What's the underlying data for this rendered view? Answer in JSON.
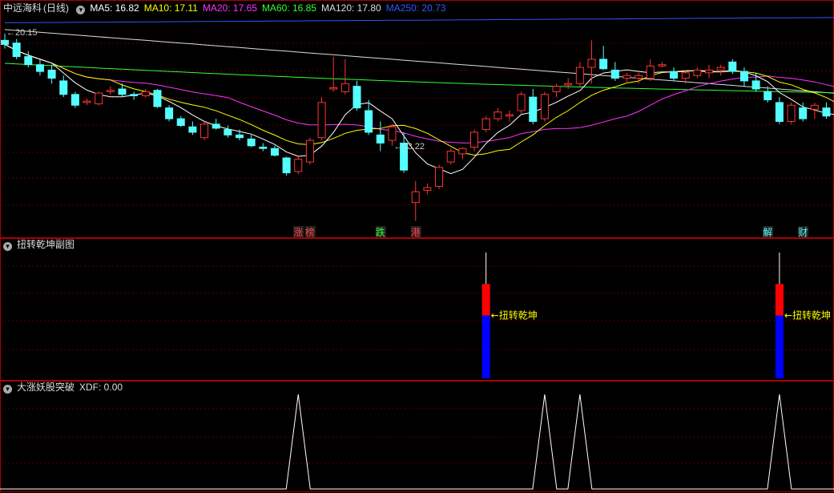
{
  "header": {
    "stock_name": "中远海科",
    "period": "(日线)",
    "ma": [
      {
        "label": "MA5: 16.82",
        "color": "#ffffff"
      },
      {
        "label": "MA10: 17.11",
        "color": "#ffff00"
      },
      {
        "label": "MA20: 17.65",
        "color": "#ff33ff"
      },
      {
        "label": "MA60: 16.85",
        "color": "#33ff33"
      },
      {
        "label": "MA120: 17.80",
        "color": "#dddddd"
      },
      {
        "label": "MA250: 20.73",
        "color": "#3355ff"
      }
    ]
  },
  "panel2": {
    "title": "扭转乾坤副图"
  },
  "panel3": {
    "title": "大涨妖股突破",
    "value_label": "XDF: 0.00"
  },
  "colors": {
    "up": "#ff3333",
    "down": "#54ffff",
    "grid": "#5a0000",
    "border": "#aa0000"
  },
  "chart_data": [
    {
      "type": "candlestick",
      "title": "中远海科 (日线)",
      "annotations": [
        {
          "text": "20.15",
          "at_index": 0,
          "kind": "high"
        },
        {
          "text": "13.22",
          "at_index": 33,
          "kind": "low"
        }
      ],
      "event_tags": [
        {
          "text": "涨",
          "at_index": 25,
          "color": "#ff4444"
        },
        {
          "text": "榜",
          "at_index": 26,
          "color": "#ff4444"
        },
        {
          "text": "跌",
          "at_index": 32,
          "color": "#33ff33"
        },
        {
          "text": "港",
          "at_index": 35,
          "color": "#ff4444"
        },
        {
          "text": "解",
          "at_index": 65,
          "color": "#54ffff"
        },
        {
          "text": "财",
          "at_index": 68,
          "color": "#54ffff"
        }
      ],
      "ohlc": [
        [
          19.9,
          20.15,
          19.6,
          19.75
        ],
        [
          19.8,
          19.95,
          19.2,
          19.3
        ],
        [
          19.3,
          19.5,
          18.9,
          19.0
        ],
        [
          19.0,
          19.2,
          18.6,
          18.75
        ],
        [
          18.8,
          19.0,
          18.3,
          18.5
        ],
        [
          18.4,
          18.6,
          17.8,
          17.9
        ],
        [
          17.9,
          18.0,
          17.4,
          17.5
        ],
        [
          17.6,
          17.75,
          17.5,
          17.65
        ],
        [
          17.55,
          18.0,
          17.5,
          17.95
        ],
        [
          18.0,
          18.2,
          17.9,
          18.05
        ],
        [
          18.1,
          18.3,
          17.8,
          17.9
        ],
        [
          17.9,
          18.0,
          17.7,
          17.85
        ],
        [
          17.85,
          18.1,
          17.8,
          18.0
        ],
        [
          18.05,
          18.1,
          17.4,
          17.45
        ],
        [
          17.4,
          17.5,
          16.9,
          17.0
        ],
        [
          17.0,
          17.1,
          16.7,
          16.75
        ],
        [
          16.7,
          16.9,
          16.4,
          16.5
        ],
        [
          16.3,
          16.9,
          16.2,
          16.8
        ],
        [
          16.8,
          17.0,
          16.6,
          16.65
        ],
        [
          16.6,
          16.75,
          16.3,
          16.4
        ],
        [
          16.4,
          16.6,
          16.2,
          16.3
        ],
        [
          16.25,
          16.4,
          15.95,
          16.0
        ],
        [
          15.95,
          16.1,
          15.8,
          15.9
        ],
        [
          15.9,
          16.0,
          15.6,
          15.65
        ],
        [
          15.55,
          15.6,
          14.9,
          15.0
        ],
        [
          15.05,
          15.6,
          14.95,
          15.5
        ],
        [
          15.4,
          16.3,
          15.3,
          16.2
        ],
        [
          16.3,
          17.8,
          16.2,
          17.6
        ],
        [
          18.1,
          19.3,
          18.0,
          18.15
        ],
        [
          18.0,
          19.2,
          17.9,
          18.3
        ],
        [
          18.2,
          18.4,
          17.3,
          17.4
        ],
        [
          17.3,
          17.7,
          16.4,
          16.5
        ],
        [
          16.4,
          16.9,
          15.8,
          16.1
        ],
        [
          16.2,
          16.8,
          16.0,
          16.7
        ],
        [
          16.1,
          16.5,
          15.0,
          15.1
        ],
        [
          13.9,
          14.7,
          13.22,
          14.3
        ],
        [
          14.35,
          14.6,
          14.2,
          14.45
        ],
        [
          14.5,
          15.3,
          14.4,
          15.2
        ],
        [
          15.4,
          15.9,
          15.3,
          15.8
        ],
        [
          15.7,
          15.95,
          15.5,
          15.9
        ],
        [
          15.95,
          16.6,
          15.8,
          16.5
        ],
        [
          16.6,
          17.1,
          16.5,
          17.0
        ],
        [
          17.0,
          17.4,
          16.9,
          17.25
        ],
        [
          17.1,
          17.3,
          16.9,
          17.15
        ],
        [
          17.3,
          18.0,
          17.2,
          17.9
        ],
        [
          17.8,
          18.1,
          16.8,
          16.9
        ],
        [
          17.0,
          18.0,
          16.9,
          17.9
        ],
        [
          18.0,
          18.3,
          17.8,
          18.2
        ],
        [
          18.25,
          18.5,
          18.1,
          18.3
        ],
        [
          18.3,
          19.1,
          18.2,
          18.9
        ],
        [
          18.9,
          19.9,
          18.3,
          19.2
        ],
        [
          19.2,
          19.7,
          18.8,
          18.85
        ],
        [
          18.8,
          19.1,
          18.4,
          18.5
        ],
        [
          18.5,
          18.7,
          18.3,
          18.6
        ],
        [
          18.5,
          18.7,
          18.3,
          18.6
        ],
        [
          18.5,
          19.2,
          18.4,
          18.95
        ],
        [
          18.95,
          19.1,
          18.9,
          19.0
        ],
        [
          18.75,
          18.9,
          18.4,
          18.5
        ],
        [
          18.5,
          18.8,
          18.3,
          18.7
        ],
        [
          18.6,
          18.9,
          18.5,
          18.8
        ],
        [
          18.7,
          19.0,
          18.5,
          18.8
        ],
        [
          18.8,
          19.0,
          18.6,
          18.9
        ],
        [
          19.1,
          19.2,
          18.65,
          18.75
        ],
        [
          18.75,
          18.9,
          18.2,
          18.4
        ],
        [
          18.4,
          18.7,
          18.0,
          18.1
        ],
        [
          18.0,
          18.2,
          17.6,
          17.7
        ],
        [
          17.6,
          17.8,
          16.8,
          16.9
        ],
        [
          16.9,
          17.6,
          16.8,
          17.5
        ],
        [
          17.4,
          17.6,
          16.9,
          17.0
        ],
        [
          17.35,
          17.6,
          17.0,
          17.5
        ],
        [
          17.4,
          17.6,
          17.0,
          17.1
        ],
        [
          17.2,
          17.3,
          16.5,
          16.6
        ]
      ],
      "ma_lines": [
        {
          "name": "MA5",
          "color": "#ffffff"
        },
        {
          "name": "MA10",
          "color": "#ffff00"
        },
        {
          "name": "MA20",
          "color": "#ff33ff"
        },
        {
          "name": "MA60",
          "color": "#33ff33"
        },
        {
          "name": "MA120",
          "color": "#dddddd"
        },
        {
          "name": "MA250",
          "color": "#3355ff"
        }
      ],
      "ylim": [
        13.0,
        20.8
      ]
    },
    {
      "type": "bar",
      "title": "扭转乾坤副图",
      "signals": [
        {
          "at_index": 41,
          "label": "扭转乾坤",
          "red": [
            0.5,
            0.75
          ],
          "blue": [
            0,
            0.5
          ],
          "line": [
            0.75,
            1.0
          ]
        },
        {
          "at_index": 66,
          "label": "扭转乾坤",
          "red": [
            0.5,
            0.75
          ],
          "blue": [
            0,
            0.5
          ],
          "line": [
            0.75,
            1.0
          ]
        }
      ]
    },
    {
      "type": "line",
      "title": "大涨妖股突破",
      "series": [
        {
          "name": "XDF",
          "spikes_at_index": [
            25,
            46,
            49,
            66
          ],
          "values_spike": 1,
          "values_base": 0
        }
      ]
    }
  ]
}
